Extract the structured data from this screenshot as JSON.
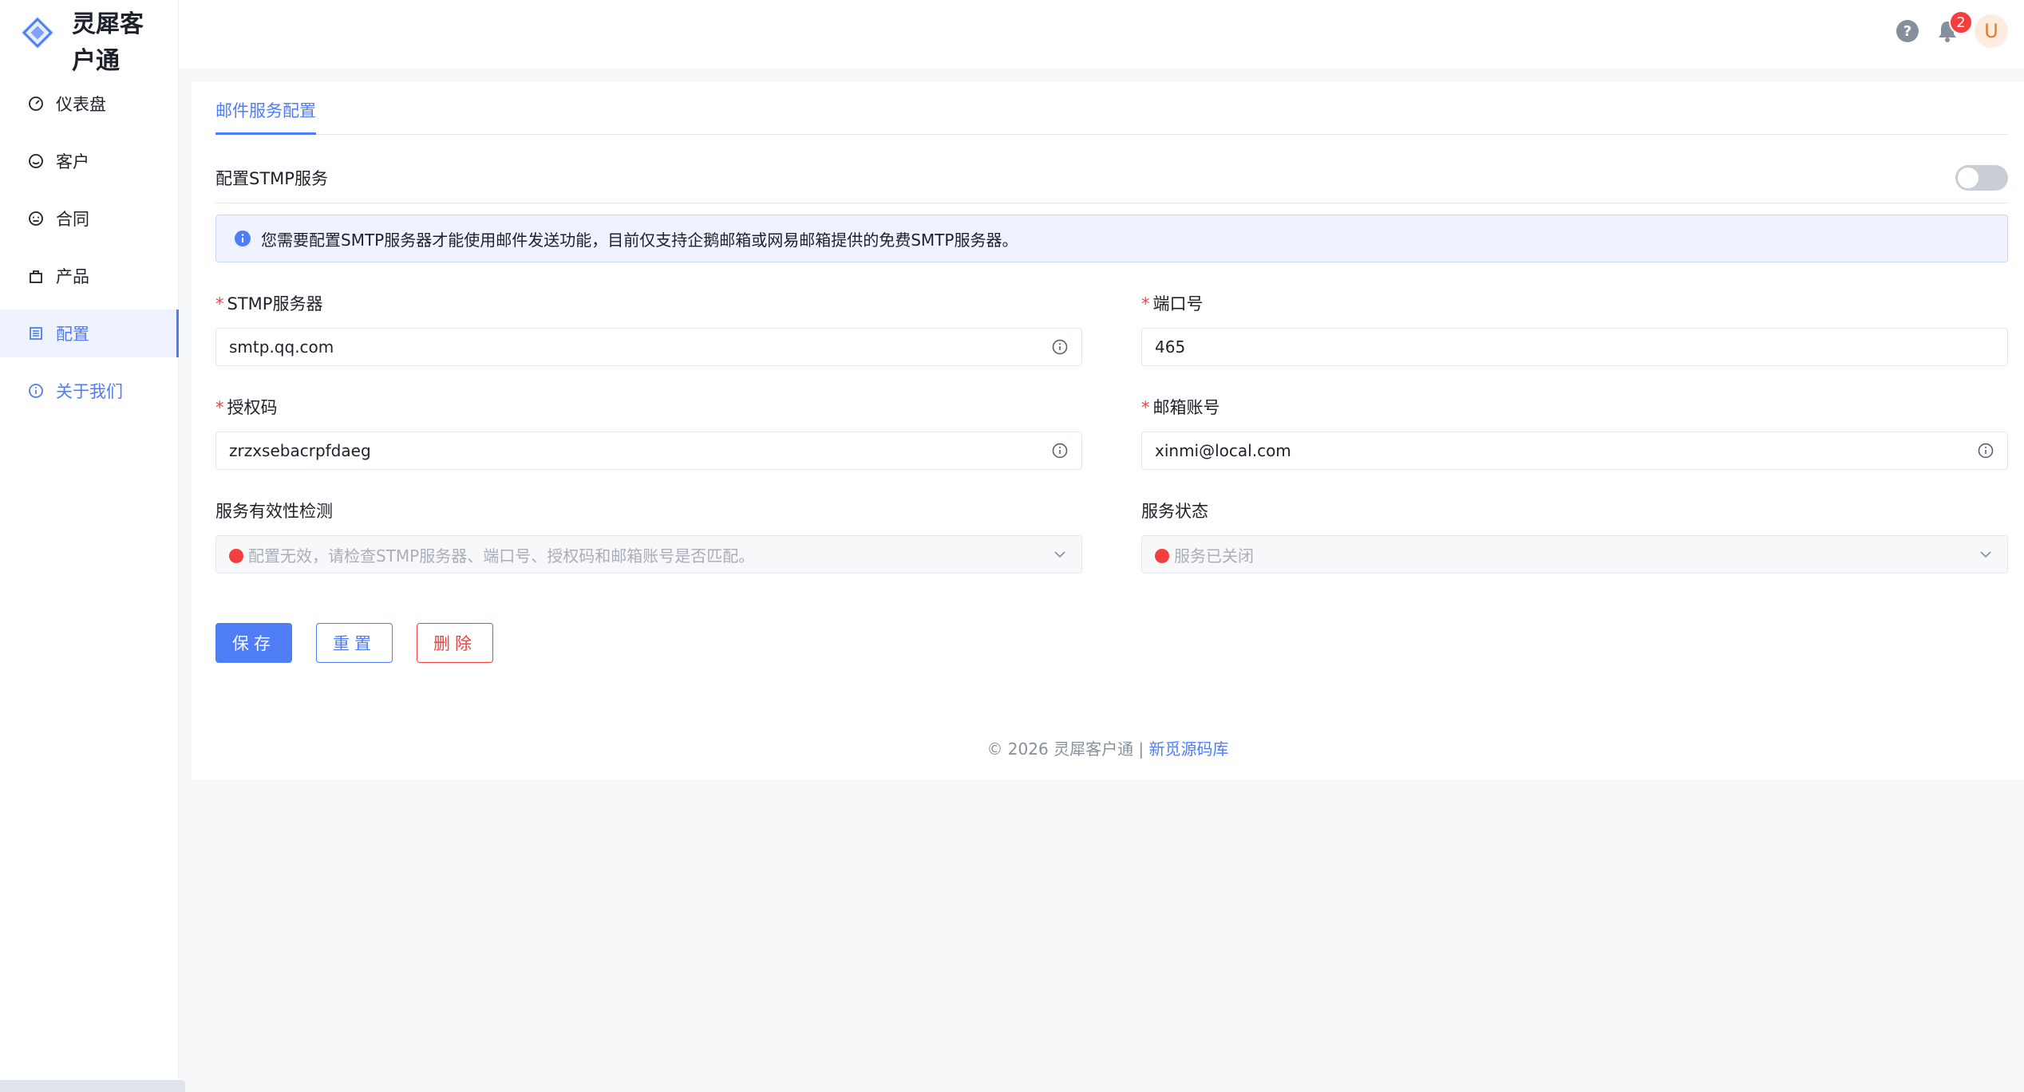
{
  "app": {
    "name": "灵犀客户通"
  },
  "sidebar": {
    "items": [
      {
        "label": "仪表盘",
        "icon": "dashboard-icon"
      },
      {
        "label": "客户",
        "icon": "smile-icon"
      },
      {
        "label": "合同",
        "icon": "face-icon"
      },
      {
        "label": "产品",
        "icon": "bag-icon"
      },
      {
        "label": "配置",
        "icon": "list-icon",
        "active": true
      },
      {
        "label": "关于我们",
        "icon": "info-icon"
      }
    ]
  },
  "header": {
    "help_icon": "question-circle-icon",
    "bell_icon": "bell-icon",
    "notification_count": "2",
    "avatar_initial": "U"
  },
  "tabs": [
    {
      "label": "邮件服务配置",
      "active": true
    }
  ],
  "smtp": {
    "toggle_label": "配置STMP服务",
    "toggle_on": false,
    "alert_text": "您需要配置SMTP服务器才能使用邮件发送功能，目前仅支持企鹅邮箱或网易邮箱提供的免费SMTP服务器。",
    "server_label": "STMP服务器",
    "server_value": "smtp.qq.com",
    "port_label": "端口号",
    "port_value": "465",
    "auth_label": "授权码",
    "auth_value": "zrzxsebacrpfdaeg",
    "account_label": "邮箱账号",
    "account_value": "xinmi@local.com",
    "check_label": "服务有效性检测",
    "check_value": "配置无效，请检查STMP服务器、端口号、授权码和邮箱账号是否匹配。",
    "status_label": "服务状态",
    "status_value": "服务已关闭"
  },
  "buttons": {
    "save": "保存",
    "reset": "重置",
    "delete": "删除"
  },
  "footer": {
    "copyright": "© 2026 灵犀客户通 | ",
    "link": "新觅源码库"
  },
  "colors": {
    "primary": "#4e7df5",
    "danger": "#f53f3f",
    "warning_avatar": "#e8762d"
  }
}
